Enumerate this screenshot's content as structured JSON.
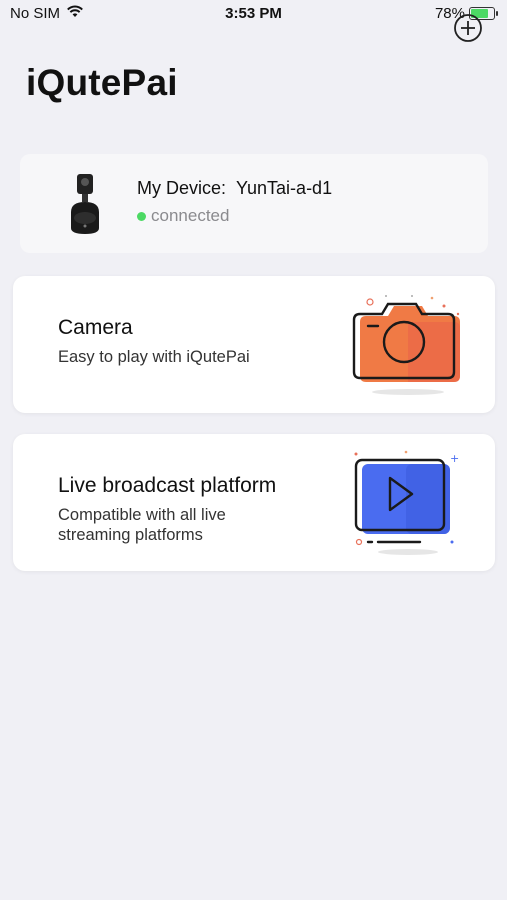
{
  "status_bar": {
    "carrier": "No SIM",
    "time": "3:53 PM",
    "battery": "78%",
    "battery_level": 0.78
  },
  "header": {
    "title": "iQutePai",
    "add_icon": "plus-circle-icon"
  },
  "device": {
    "label": "My Device:",
    "name": "YunTai-a-d1",
    "status": "connected",
    "status_color": "#4cd964"
  },
  "cards": {
    "camera": {
      "title": "Camera",
      "description": "Easy to play with iQutePai",
      "icon": "camera-icon",
      "accent": "#f07a45"
    },
    "live": {
      "title": "Live broadcast platform",
      "description": "Compatible with all live streaming platforms",
      "icon": "play-screen-icon",
      "accent": "#4a6cf0"
    }
  }
}
